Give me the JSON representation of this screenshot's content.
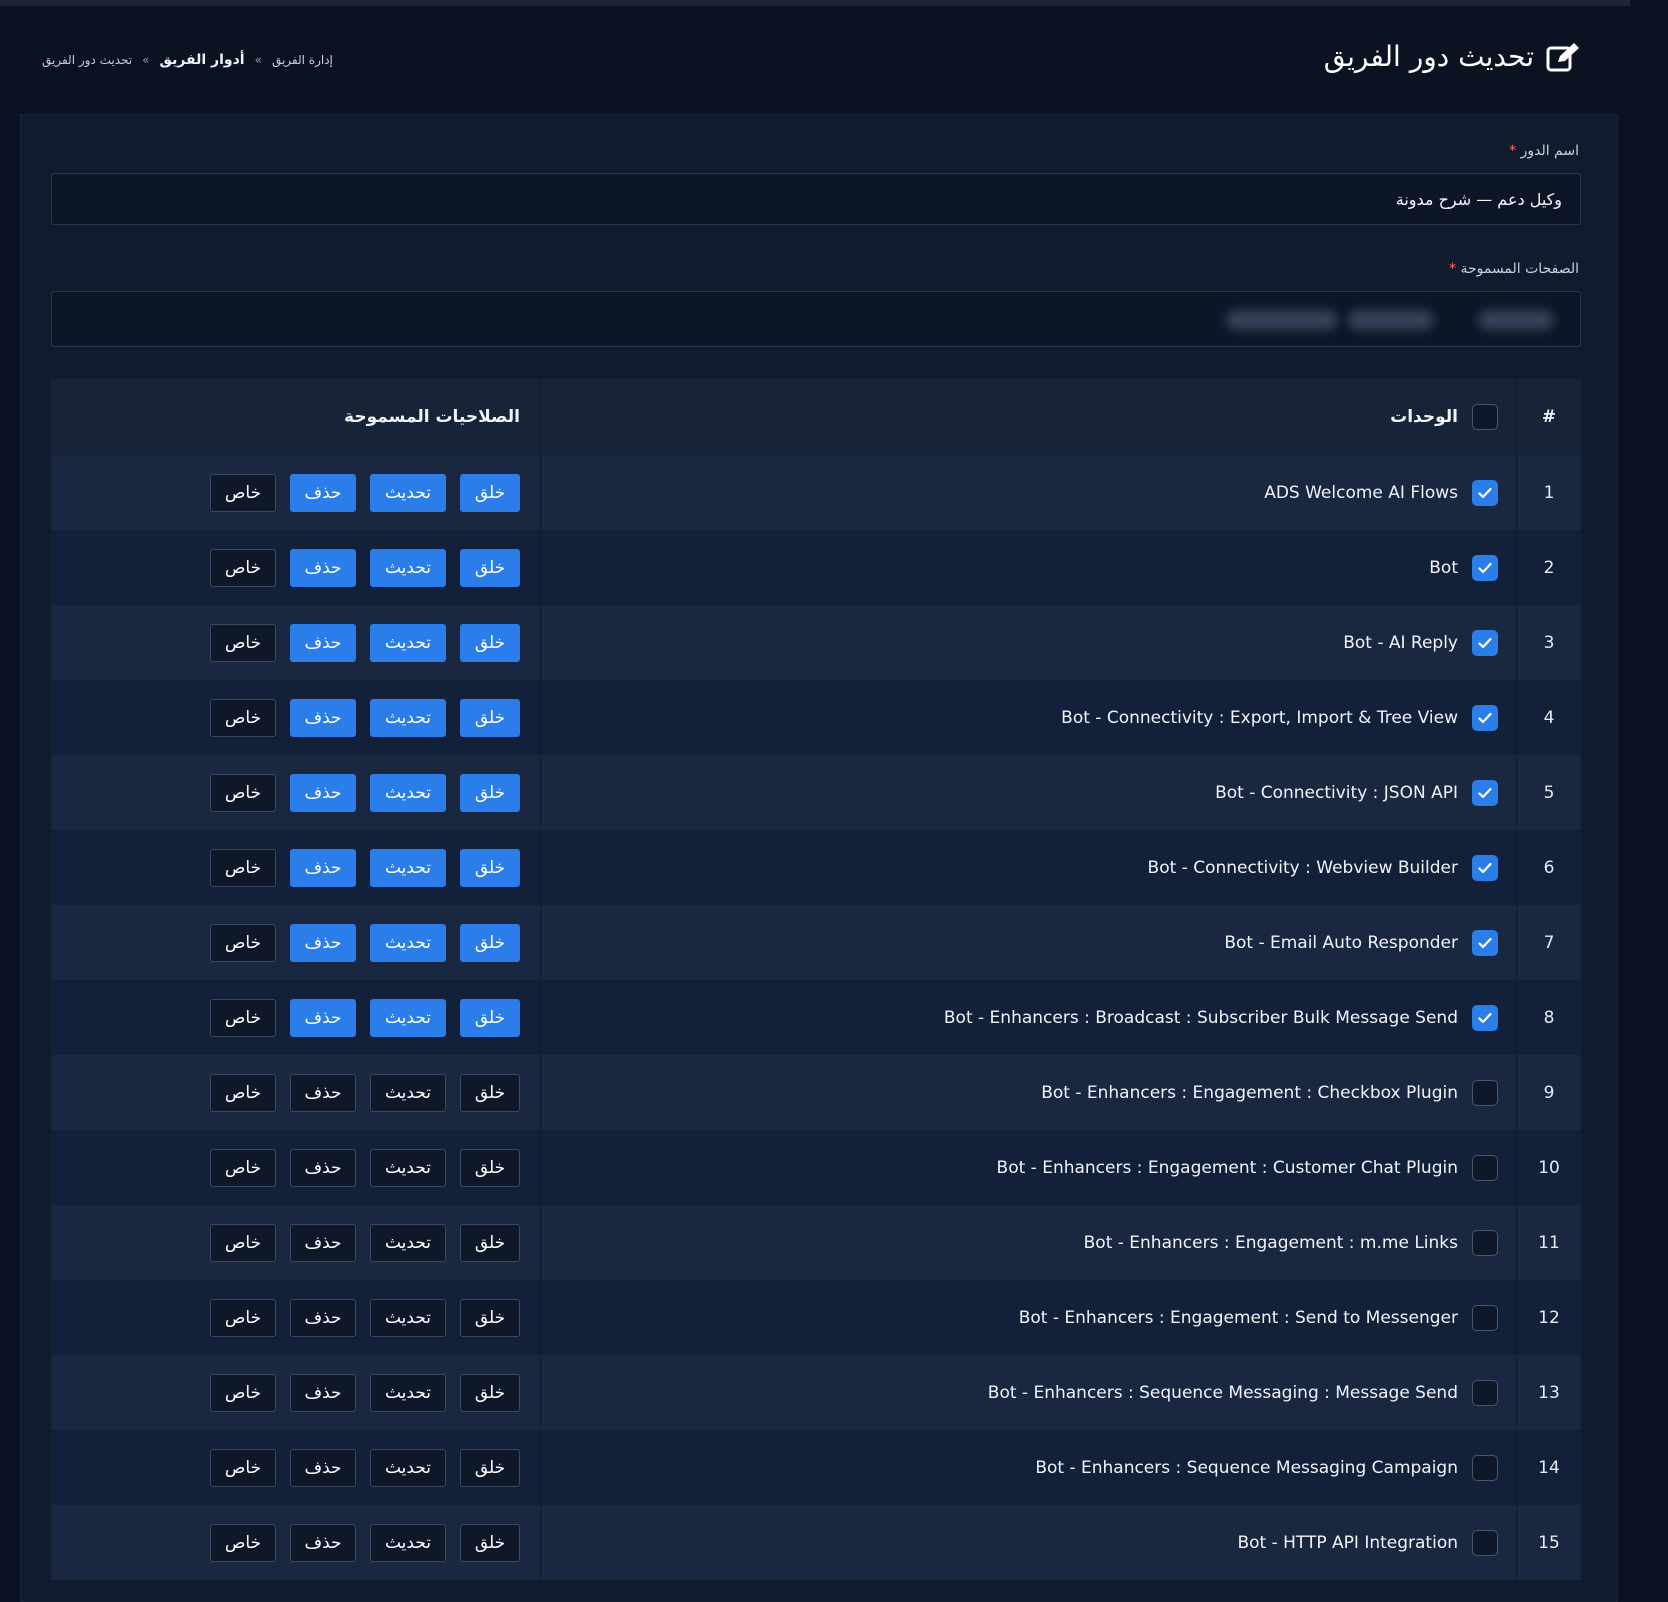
{
  "page": {
    "title": "تحديث دور الفريق",
    "breadcrumb": [
      "إدارة الفريق",
      "أدوار الفريق",
      "تحديث دور الفريق"
    ],
    "breadcrumb_separator": "»"
  },
  "form": {
    "role_label": "اسم الدور",
    "role_value": "وكيل دعم — شرح مدونة",
    "pages_label": "الصفحات المسموحة",
    "required_mark": "*"
  },
  "table": {
    "headers": {
      "number": "#",
      "modules": "الوحدات",
      "permissions": "الصلاحيات المسموحة"
    },
    "buttons": {
      "create": "خلق",
      "update": "تحديث",
      "delete": "حذف",
      "private": "خاص"
    },
    "rows": [
      {
        "num": "1",
        "module": "ADS Welcome AI Flows",
        "checked": true
      },
      {
        "num": "2",
        "module": "Bot",
        "checked": true
      },
      {
        "num": "3",
        "module": "Bot - AI Reply",
        "checked": true
      },
      {
        "num": "4",
        "module": "Bot - Connectivity : Export, Import & Tree View",
        "checked": true
      },
      {
        "num": "5",
        "module": "Bot - Connectivity : JSON API",
        "checked": true
      },
      {
        "num": "6",
        "module": "Bot - Connectivity : Webview Builder",
        "checked": true
      },
      {
        "num": "7",
        "module": "Bot - Email Auto Responder",
        "checked": true
      },
      {
        "num": "8",
        "module": "Bot - Enhancers : Broadcast : Subscriber Bulk Message Send",
        "checked": true
      },
      {
        "num": "9",
        "module": "Bot - Enhancers : Engagement : Checkbox Plugin",
        "checked": false
      },
      {
        "num": "10",
        "module": "Bot - Enhancers : Engagement : Customer Chat Plugin",
        "checked": false
      },
      {
        "num": "11",
        "module": "Bot - Enhancers : Engagement : m.me Links",
        "checked": false
      },
      {
        "num": "12",
        "module": "Bot - Enhancers : Engagement : Send to Messenger",
        "checked": false
      },
      {
        "num": "13",
        "module": "Bot - Enhancers : Sequence Messaging : Message Send",
        "checked": false
      },
      {
        "num": "14",
        "module": "Bot - Enhancers : Sequence Messaging Campaign",
        "checked": false
      },
      {
        "num": "15",
        "module": "Bot - HTTP API Integration",
        "checked": false
      }
    ]
  },
  "colors": {
    "accent": "#2b7de9",
    "background": "#0b1221",
    "card": "#111b2e"
  },
  "icons": {
    "title": "edit-icon",
    "checkbox_checked": "check-icon"
  }
}
